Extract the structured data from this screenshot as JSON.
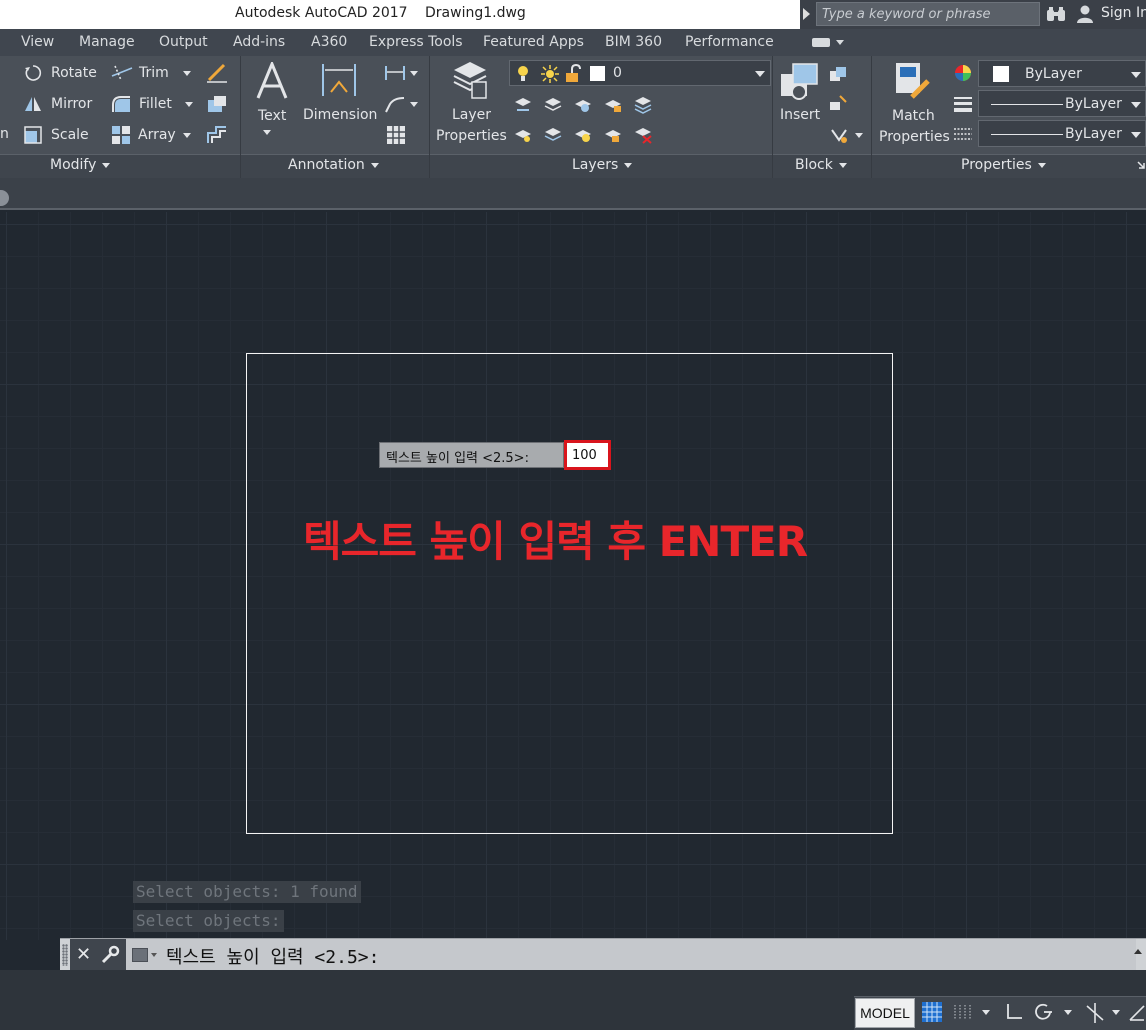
{
  "titlebar": {
    "app_title": "Autodesk AutoCAD 2017",
    "document": "Drawing1.dwg",
    "search_placeholder": "Type a keyword or phrase",
    "sign_in": "Sign In"
  },
  "menu_tabs": [
    "View",
    "Manage",
    "Output",
    "Add-ins",
    "A360",
    "Express Tools",
    "Featured Apps",
    "BIM 360",
    "Performance"
  ],
  "ribbon": {
    "modify": {
      "rotate": "Rotate",
      "mirror": "Mirror",
      "scale": "Scale",
      "trim": "Trim",
      "fillet": "Fillet",
      "array": "Array",
      "partial": "n",
      "panel_label": "Modify"
    },
    "annotation": {
      "text": "Text",
      "dimension": "Dimension",
      "panel_label": "Annotation"
    },
    "layers": {
      "layer_properties_line1": "Layer",
      "layer_properties_line2": "Properties",
      "current_layer": "0",
      "panel_label": "Layers"
    },
    "block": {
      "insert": "Insert",
      "panel_label": "Block"
    },
    "properties": {
      "match_line1": "Match",
      "match_line2": "Properties",
      "color": "ByLayer",
      "linetype": "ByLayer",
      "lineweight": "ByLayer",
      "panel_label": "Properties"
    }
  },
  "canvas": {
    "dynamic_prompt": "텍스트 높이 입력 <2.5>:",
    "dynamic_input_value": "100",
    "annotation": "텍스트 높이 입력 후 ENTER"
  },
  "command": {
    "history": [
      "Select objects: 1 found",
      "Select objects:"
    ],
    "current_prompt": "텍스트 높이 입력 <2.5>:"
  },
  "status": {
    "model": "MODEL"
  },
  "colors": {
    "accent_red": "#e8262b",
    "canvas_bg": "#212830"
  }
}
